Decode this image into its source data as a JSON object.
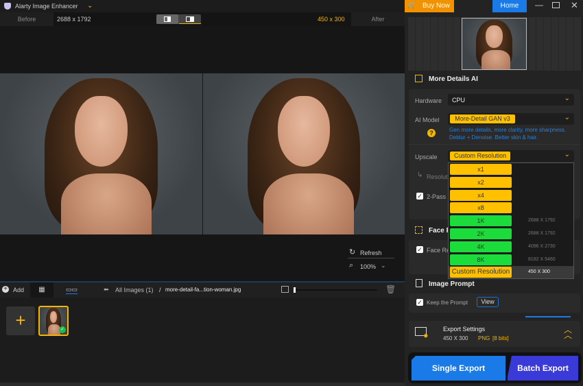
{
  "app": {
    "title": "Alarty Image Enhancer"
  },
  "compare": {
    "before_label": "Before",
    "before_size": "2688 x 1792",
    "after_size": "450 x 300",
    "after_label": "After"
  },
  "preview": {
    "refresh": "Refresh",
    "zoom": "100%"
  },
  "toolbar": {
    "add": "Add",
    "breadcrumb_root": "All Images (1)",
    "separator": "/",
    "filename": "more-detail-fa...tion-woman.jpg"
  },
  "header": {
    "buy_now": "Buy Now",
    "home": "Home"
  },
  "section": {
    "title": "More Details AI"
  },
  "settings": {
    "hardware_label": "Hardware",
    "hardware_value": "CPU",
    "model_label": "AI Model",
    "model_value": "More-Detail GAN  v3",
    "model_desc_1": "Gen more details, more clarity, more sharpness.",
    "model_desc_2": "Deblur + Denoise. Better skin & hair.",
    "upscale_label": "Upscale",
    "upscale_value": "Custom Resolution",
    "resolution_label": "Resoluti",
    "two_pass": "2-Pass"
  },
  "dropdown": {
    "options": [
      {
        "label": "x1",
        "res": "",
        "color": "#ffc000"
      },
      {
        "label": "x2",
        "res": "",
        "color": "#ffc000"
      },
      {
        "label": "x4",
        "res": "",
        "color": "#ffc000"
      },
      {
        "label": "x8",
        "res": "",
        "color": "#ffc000"
      },
      {
        "label": "1K",
        "res": "2688 X 1792",
        "color": "#1bdc3a"
      },
      {
        "label": "2K",
        "res": "2688 X 1792",
        "color": "#1bdc3a"
      },
      {
        "label": "4K",
        "res": "4096 X 2730",
        "color": "#1bdc3a"
      },
      {
        "label": "8K",
        "res": "8192 X 5460",
        "color": "#1bdc3a"
      },
      {
        "label": "Custom Resolution",
        "res": "450 X 300",
        "color": "#ffc000",
        "selected": true
      }
    ]
  },
  "face": {
    "title": "Face R",
    "option": "Face Re"
  },
  "prompt": {
    "title": "Image Prompt",
    "keep": "Keep the Prompt",
    "view": "View"
  },
  "export": {
    "title": "Export Settings",
    "size": "450 X 300",
    "format": "PNG",
    "bits": "[8 bits]",
    "single": "Single Export",
    "batch": "Batch Export"
  },
  "colors": {
    "accent": "#f5b400",
    "blue": "#1a7ae8",
    "purple": "#3a3ad8"
  }
}
